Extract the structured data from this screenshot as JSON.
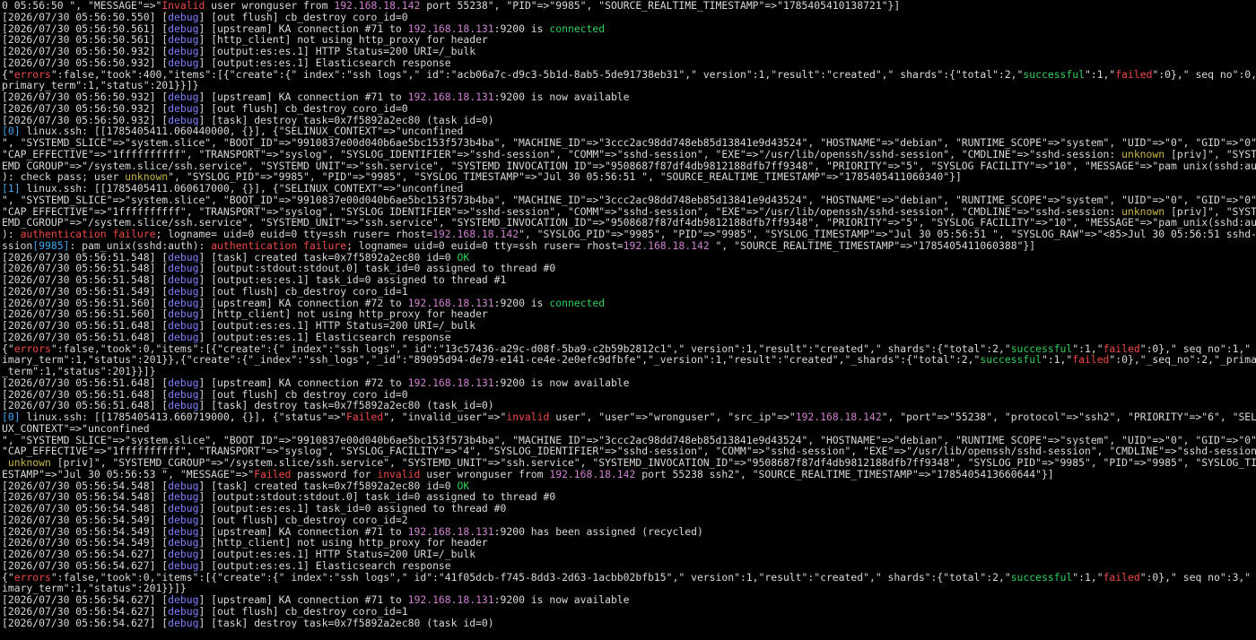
{
  "colors": {
    "background": "#000000",
    "d": "#d9d9d9",
    "dbg": "#7f7fff",
    "ip": "#d07fd0",
    "ok": "#2fd05a",
    "red": "#f04848",
    "yel": "#c9b64a",
    "cyn": "#3fa6f0"
  },
  "terminal": {
    "lines": [
      [
        [
          "d",
          "0 05:56:50 \", \"MESSAGE\"=>\""
        ],
        [
          "red",
          "Invalid"
        ],
        [
          "d",
          " user wronguser from "
        ],
        [
          "ip",
          "192.168.18.142"
        ],
        [
          "d",
          " port 55238\", \"PID\"=>\"9985\", \"SOURCE_REALTIME_TIMESTAMP\"=>\"1785405410138721\"}]"
        ]
      ],
      [
        [
          "d",
          "[2026/07/30 05:56:50.550] ["
        ],
        [
          "dbg",
          "debug"
        ],
        [
          "d",
          "] [out flush] cb_destroy coro_id=0"
        ]
      ],
      [
        [
          "d",
          "[2026/07/30 05:56:50.561] ["
        ],
        [
          "dbg",
          "debug"
        ],
        [
          "d",
          "] [upstream] KA connection #71 to "
        ],
        [
          "ip",
          "192.168.18.131"
        ],
        [
          "d",
          ":9200 is "
        ],
        [
          "ok",
          "connected"
        ]
      ],
      [
        [
          "d",
          "[2026/07/30 05:56:50.561] ["
        ],
        [
          "dbg",
          "debug"
        ],
        [
          "d",
          "] [http_client] not using http_proxy for header"
        ]
      ],
      [
        [
          "d",
          "[2026/07/30 05:56:50.932] ["
        ],
        [
          "dbg",
          "debug"
        ],
        [
          "d",
          "] [output:es:es.1] HTTP Status=200 URI=/_bulk"
        ]
      ],
      [
        [
          "d",
          "[2026/07/30 05:56:50.932] ["
        ],
        [
          "dbg",
          "debug"
        ],
        [
          "d",
          "] [output:es:es.1] Elasticsearch response"
        ]
      ],
      [
        [
          "d",
          "{\""
        ],
        [
          "red",
          "errors"
        ],
        [
          "d",
          "\":false,\"took\":400,\"items\":[{\"create\":{\"_index\":\"ssh_logs\",\"_id\":\"acb06a7c-d9c3-5b1d-8ab5-5de91738eb31\",\"_version\":1,\"result\":\"created\",\"_shards\":{\"total\":2,\""
        ],
        [
          "ok",
          "successful"
        ],
        [
          "d",
          "\":1,\""
        ],
        [
          "red",
          "failed"
        ],
        [
          "d",
          "\":0},\"_seq_no\":0,\"_"
        ]
      ],
      [
        [
          "d",
          "primary_term\":1,\"status\":201}}]}"
        ]
      ],
      [
        [
          "d",
          "[2026/07/30 05:56:50.932] ["
        ],
        [
          "dbg",
          "debug"
        ],
        [
          "d",
          "] [upstream] KA connection #71 to "
        ],
        [
          "ip",
          "192.168.18.131"
        ],
        [
          "d",
          ":9200 is now available"
        ]
      ],
      [
        [
          "d",
          "[2026/07/30 05:56:50.932] ["
        ],
        [
          "dbg",
          "debug"
        ],
        [
          "d",
          "] [out flush] cb_destroy coro_id=0"
        ]
      ],
      [
        [
          "d",
          "[2026/07/30 05:56:50.932] ["
        ],
        [
          "dbg",
          "debug"
        ],
        [
          "d",
          "] [task] destroy task=0x7f5892a2ec80 (task_id=0)"
        ]
      ],
      [
        [
          "cyn",
          "[0]"
        ],
        [
          "d",
          " linux.ssh: [[1785405411.060440000, {}], {\"SELINUX_CONTEXT\"=>\"unconfined"
        ]
      ],
      [
        [
          "d",
          "\", \"SYSTEMD_SLICE\"=>\"system.slice\", \"BOOT_ID\"=>\"9910837e00d040b6ae5bc153f573b4ba\", \"MACHINE_ID\"=>\"3ccc2ac98dd748eb85d13841e9d43524\", \"HOSTNAME\"=>\"debian\", \"RUNTIME_SCOPE\"=>\"system\", \"UID\"=>\"0\", \"GID\"=>\"0\","
        ]
      ],
      [
        [
          "d",
          "\"CAP_EFFECTIVE\"=>\"1ffffffffff\", \"TRANSPORT\"=>\"syslog\", \"SYSLOG_IDENTIFIER\"=>\"sshd-session\", \"COMM\"=>\"sshd-session\", \"EXE\"=>\"/usr/lib/openssh/sshd-session\", \"CMDLINE\"=>\"sshd-session: "
        ],
        [
          "yel",
          "unknown"
        ],
        [
          "d",
          " [priv]\", \"SYST"
        ]
      ],
      [
        [
          "d",
          "EMD_CGROUP\"=>\"/system.slice/ssh.service\", \"SYSTEMD_UNIT\"=>\"ssh.service\", \"SYSTEMD_INVOCATION_ID\"=>\"9508687f87df4db9812188dfb7ff9348\", \"PRIORITY\"=>\"5\", \"SYSLOG_FACILITY\"=>\"10\", \"MESSAGE\"=>\"pam_unix(sshd:auth"
        ]
      ],
      [
        [
          "d",
          "): check pass; user "
        ],
        [
          "yel",
          "unknown"
        ],
        [
          "d",
          "\", \"SYSLOG_PID\"=>\"9985\", \"PID\"=>\"9985\", \"SYSLOG_TIMESTAMP\"=>\"Jul 30 05:56:51 \", \"SOURCE_REALTIME_TIMESTAMP\"=>\"1785405411060340\"}]"
        ]
      ],
      [
        [
          "cyn",
          "[1]"
        ],
        [
          "d",
          " linux.ssh: [[1785405411.060617000, {}], {\"SELINUX_CONTEXT\"=>\"unconfined"
        ]
      ],
      [
        [
          "d",
          "\", \"SYSTEMD_SLICE\"=>\"system.slice\", \"BOOT_ID\"=>\"9910837e00d040b6ae5bc153f573b4ba\", \"MACHINE_ID\"=>\"3ccc2ac98dd748eb85d13841e9d43524\", \"HOSTNAME\"=>\"debian\", \"RUNTIME_SCOPE\"=>\"system\", \"UID\"=>\"0\", \"GID\"=>\"0\","
        ]
      ],
      [
        [
          "d",
          "\"CAP_EFFECTIVE\"=>\"1ffffffffff\", \"TRANSPORT\"=>\"syslog\", \"SYSLOG_IDENTIFIER\"=>\"sshd-session\", \"COMM\"=>\"sshd-session\", \"EXE\"=>\"/usr/lib/openssh/sshd-session\", \"CMDLINE\"=>\"sshd-session: "
        ],
        [
          "yel",
          "unknown"
        ],
        [
          "d",
          " [priv]\", \"SYST"
        ]
      ],
      [
        [
          "d",
          "EMD_CGROUP\"=>\"/system.slice/ssh.service\", \"SYSTEMD_UNIT\"=>\"ssh.service\", \"SYSTEMD_INVOCATION_ID\"=>\"9508687f87df4db9812188dfb7ff9348\", \"PRIORITY\"=>\"5\", \"SYSLOG_FACILITY\"=>\"10\", \"MESSAGE\"=>\"pam_unix(sshd:auth"
        ]
      ],
      [
        [
          "d",
          "): "
        ],
        [
          "red",
          "authentication failure"
        ],
        [
          "d",
          "; logname= uid=0 euid=0 tty=ssh ruser= rhost="
        ],
        [
          "ip",
          "192.168.18.142"
        ],
        [
          "d",
          "\", \"SYSLOG_PID\"=>\"9985\", \"PID\"=>\"9985\", \"SYSLOG_TIMESTAMP\"=>\"Jul 30 05:56:51 \", \"SYSLOG_RAW\"=>\"<85>Jul 30 05:56:51 sshd-se"
        ]
      ],
      [
        [
          "d",
          "ssion"
        ],
        [
          "cyn",
          "[9985]"
        ],
        [
          "d",
          ": pam_unix(sshd:auth): "
        ],
        [
          "red",
          "authentication failure"
        ],
        [
          "d",
          "; logname= uid=0 euid=0 tty=ssh ruser= rhost="
        ],
        [
          "ip",
          "192.168.18.142"
        ],
        [
          "d",
          " \", \"SOURCE_REALTIME_TIMESTAMP\"=>\"1785405411060388\"}]"
        ]
      ],
      [
        [
          "d",
          "[2026/07/30 05:56:51.548] ["
        ],
        [
          "dbg",
          "debug"
        ],
        [
          "d",
          "] [task] created task=0x7f5892a2ec80 id=0 "
        ],
        [
          "ok",
          "OK"
        ]
      ],
      [
        [
          "d",
          "[2026/07/30 05:56:51.548] ["
        ],
        [
          "dbg",
          "debug"
        ],
        [
          "d",
          "] [output:stdout:stdout.0] task_id=0 assigned to thread #0"
        ]
      ],
      [
        [
          "d",
          "[2026/07/30 05:56:51.548] ["
        ],
        [
          "dbg",
          "debug"
        ],
        [
          "d",
          "] [output:es:es.1] task_id=0 assigned to thread #1"
        ]
      ],
      [
        [
          "d",
          "[2026/07/30 05:56:51.549] ["
        ],
        [
          "dbg",
          "debug"
        ],
        [
          "d",
          "] [out flush] cb_destroy coro_id=1"
        ]
      ],
      [
        [
          "d",
          "[2026/07/30 05:56:51.560] ["
        ],
        [
          "dbg",
          "debug"
        ],
        [
          "d",
          "] [upstream] KA connection #72 to "
        ],
        [
          "ip",
          "192.168.18.131"
        ],
        [
          "d",
          ":9200 is "
        ],
        [
          "ok",
          "connected"
        ]
      ],
      [
        [
          "d",
          "[2026/07/30 05:56:51.560] ["
        ],
        [
          "dbg",
          "debug"
        ],
        [
          "d",
          "] [http_client] not using http_proxy for header"
        ]
      ],
      [
        [
          "d",
          "[2026/07/30 05:56:51.648] ["
        ],
        [
          "dbg",
          "debug"
        ],
        [
          "d",
          "] [output:es:es.1] HTTP Status=200 URI=/_bulk"
        ]
      ],
      [
        [
          "d",
          "[2026/07/30 05:56:51.648] ["
        ],
        [
          "dbg",
          "debug"
        ],
        [
          "d",
          "] [output:es:es.1] Elasticsearch response"
        ]
      ],
      [
        [
          "d",
          "{\""
        ],
        [
          "red",
          "errors"
        ],
        [
          "d",
          "\":false,\"took\":0,\"items\":[{\"create\":{\"_index\":\"ssh_logs\",\"_id\":\"13c57436-a29c-d08f-5ba9-c2b59b2812c1\",\"_version\":1,\"result\":\"created\",\"_shards\":{\"total\":2,\""
        ],
        [
          "ok",
          "successful"
        ],
        [
          "d",
          "\":1,\""
        ],
        [
          "red",
          "failed"
        ],
        [
          "d",
          "\":0},\"_seq_no\":1,\"_pr"
        ]
      ],
      [
        [
          "d",
          "imary_term\":1,\"status\":201}},{\"create\":{\"_index\":\"ssh_logs\",\"_id\":\"89095d94-de79-e141-ce4e-2e0efc9dfbfe\",\"_version\":1,\"result\":\"created\",\"_shards\":{\"total\":2,\""
        ],
        [
          "ok",
          "successful"
        ],
        [
          "d",
          "\":1,\""
        ],
        [
          "red",
          "failed"
        ],
        [
          "d",
          "\":0},\"_seq_no\":2,\"_primary"
        ]
      ],
      [
        [
          "d",
          "_term\":1,\"status\":201}}]}"
        ]
      ],
      [
        [
          "d",
          "[2026/07/30 05:56:51.648] ["
        ],
        [
          "dbg",
          "debug"
        ],
        [
          "d",
          "] [upstream] KA connection #72 to "
        ],
        [
          "ip",
          "192.168.18.131"
        ],
        [
          "d",
          ":9200 is now available"
        ]
      ],
      [
        [
          "d",
          "[2026/07/30 05:56:51.648] ["
        ],
        [
          "dbg",
          "debug"
        ],
        [
          "d",
          "] [out flush] cb_destroy coro_id=0"
        ]
      ],
      [
        [
          "d",
          "[2026/07/30 05:56:51.648] ["
        ],
        [
          "dbg",
          "debug"
        ],
        [
          "d",
          "] [task] destroy task=0x7f5892a2ec80 (task_id=0)"
        ]
      ],
      [
        [
          "cyn",
          "[0]"
        ],
        [
          "d",
          " linux.ssh: [[1785405413.660719000, {}], {\"status\"=>\""
        ],
        [
          "red",
          "Failed"
        ],
        [
          "d",
          "\", \"invalid_user\"=>\""
        ],
        [
          "red",
          "invalid"
        ],
        [
          "d",
          " user\", \"user\"=>\"wronguser\", \"src_ip\"=>\""
        ],
        [
          "ip",
          "192.168.18.142"
        ],
        [
          "d",
          "\", \"port\"=>\"55238\", \"protocol\"=>\"ssh2\", \"PRIORITY\"=>\"6\", \"SELIN"
        ]
      ],
      [
        [
          "d",
          "UX_CONTEXT\"=>\"unconfined"
        ]
      ],
      [
        [
          "d",
          "\", \"SYSTEMD_SLICE\"=>\"system.slice\", \"BOOT_ID\"=>\"9910837e00d040b6ae5bc153f573b4ba\", \"MACHINE_ID\"=>\"3ccc2ac98dd748eb85d13841e9d43524\", \"HOSTNAME\"=>\"debian\", \"RUNTIME_SCOPE\"=>\"system\", \"UID\"=>\"0\", \"GID\"=>\"0\","
        ]
      ],
      [
        [
          "d",
          "\"CAP_EFFECTIVE\"=>\"1ffffffffff\", \"TRANSPORT\"=>\"syslog\", \"SYSLOG_FACILITY\"=>\"4\", \"SYSLOG_IDENTIFIER\"=>\"sshd-session\", \"COMM\"=>\"sshd-session\", \"EXE\"=>\"/usr/lib/openssh/sshd-session\", \"CMDLINE\"=>\"sshd-session:"
        ]
      ],
      [
        [
          "yel",
          " unknown"
        ],
        [
          "d",
          " [priv]\", \"SYSTEMD_CGROUP\"=>\"/system.slice/ssh.service\", \"SYSTEMD_UNIT\"=>\"ssh.service\", \"SYSTEMD_INVOCATION_ID\"=>\"9508687f87df4db9812188dfb7ff9348\", \"SYSLOG_PID\"=>\"9985\", \"PID\"=>\"9985\", \"SYSLOG_TIM"
        ]
      ],
      [
        [
          "d",
          "ESTAMP\"=>\"Jul 30 05:56:53 \", \"MESSAGE\"=>\""
        ],
        [
          "red",
          "Failed"
        ],
        [
          "d",
          " password for "
        ],
        [
          "red",
          "invalid"
        ],
        [
          "d",
          " user wronguser from "
        ],
        [
          "ip",
          "192.168.18.142"
        ],
        [
          "d",
          " port 55238 ssh2\", \"SOURCE_REALTIME_TIMESTAMP\"=>\"1785405413660644\"}]"
        ]
      ],
      [
        [
          "d",
          "[2026/07/30 05:56:54.548] ["
        ],
        [
          "dbg",
          "debug"
        ],
        [
          "d",
          "] [task] created task=0x7f5892a2ec80 id=0 "
        ],
        [
          "ok",
          "OK"
        ]
      ],
      [
        [
          "d",
          "[2026/07/30 05:56:54.548] ["
        ],
        [
          "dbg",
          "debug"
        ],
        [
          "d",
          "] [output:stdout:stdout.0] task_id=0 assigned to thread #0"
        ]
      ],
      [
        [
          "d",
          "[2026/07/30 05:56:54.548] ["
        ],
        [
          "dbg",
          "debug"
        ],
        [
          "d",
          "] [output:es:es.1] task_id=0 assigned to thread #0"
        ]
      ],
      [
        [
          "d",
          "[2026/07/30 05:56:54.549] ["
        ],
        [
          "dbg",
          "debug"
        ],
        [
          "d",
          "] [out flush] cb_destroy coro_id=2"
        ]
      ],
      [
        [
          "d",
          "[2026/07/30 05:56:54.549] ["
        ],
        [
          "dbg",
          "debug"
        ],
        [
          "d",
          "] [upstream] KA connection #71 to "
        ],
        [
          "ip",
          "192.168.18.131"
        ],
        [
          "d",
          ":9200 has been assigned (recycled)"
        ]
      ],
      [
        [
          "d",
          "[2026/07/30 05:56:54.549] ["
        ],
        [
          "dbg",
          "debug"
        ],
        [
          "d",
          "] [http_client] not using http_proxy for header"
        ]
      ],
      [
        [
          "d",
          "[2026/07/30 05:56:54.627] ["
        ],
        [
          "dbg",
          "debug"
        ],
        [
          "d",
          "] [output:es:es.1] HTTP Status=200 URI=/_bulk"
        ]
      ],
      [
        [
          "d",
          "[2026/07/30 05:56:54.627] ["
        ],
        [
          "dbg",
          "debug"
        ],
        [
          "d",
          "] [output:es:es.1] Elasticsearch response"
        ]
      ],
      [
        [
          "d",
          "{\""
        ],
        [
          "red",
          "errors"
        ],
        [
          "d",
          "\":false,\"took\":0,\"items\":[{\"create\":{\"_index\":\"ssh_logs\",\"_id\":\"41f05dcb-f745-8dd3-2d63-1acbb02bfb15\",\"_version\":1,\"result\":\"created\",\"_shards\":{\"total\":2,\""
        ],
        [
          "ok",
          "successful"
        ],
        [
          "d",
          "\":1,\""
        ],
        [
          "red",
          "failed"
        ],
        [
          "d",
          "\":0},\"_seq_no\":3,\"_pr"
        ]
      ],
      [
        [
          "d",
          "imary_term\":1,\"status\":201}}]}"
        ]
      ],
      [
        [
          "d",
          "[2026/07/30 05:56:54.627] ["
        ],
        [
          "dbg",
          "debug"
        ],
        [
          "d",
          "] [upstream] KA connection #71 to "
        ],
        [
          "ip",
          "192.168.18.131"
        ],
        [
          "d",
          ":9200 is now available"
        ]
      ],
      [
        [
          "d",
          "[2026/07/30 05:56:54.627] ["
        ],
        [
          "dbg",
          "debug"
        ],
        [
          "d",
          "] [out flush] cb_destroy coro_id=1"
        ]
      ],
      [
        [
          "d",
          "[2026/07/30 05:56:54.627] ["
        ],
        [
          "dbg",
          "debug"
        ],
        [
          "d",
          "] [task] destroy task=0x7f5892a2ec80 (task_id=0)"
        ]
      ]
    ]
  }
}
